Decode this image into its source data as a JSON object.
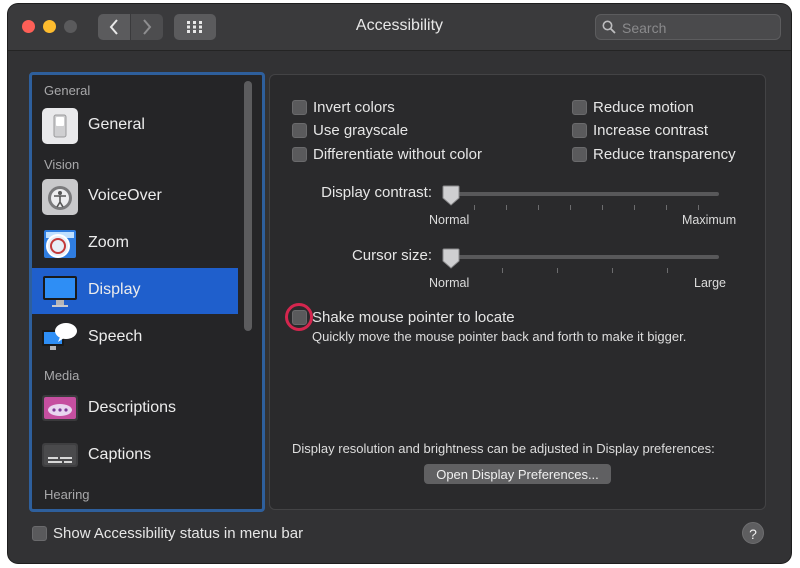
{
  "window": {
    "title": "Accessibility",
    "search_placeholder": "Search"
  },
  "sidebar": {
    "sections": {
      "general": "General",
      "vision": "Vision",
      "media": "Media",
      "hearing": "Hearing"
    },
    "items": [
      {
        "label": "General",
        "icon": "general-switch-icon"
      },
      {
        "label": "VoiceOver",
        "icon": "voiceover-icon"
      },
      {
        "label": "Zoom",
        "icon": "zoom-icon"
      },
      {
        "label": "Display",
        "icon": "display-icon",
        "selected": true
      },
      {
        "label": "Speech",
        "icon": "speech-icon"
      },
      {
        "label": "Descriptions",
        "icon": "descriptions-icon"
      },
      {
        "label": "Captions",
        "icon": "captions-icon"
      }
    ]
  },
  "display": {
    "options_left": [
      {
        "label": "Invert colors",
        "checked": false
      },
      {
        "label": "Use grayscale",
        "checked": false
      },
      {
        "label": "Differentiate without color",
        "checked": false
      }
    ],
    "options_right": [
      {
        "label": "Reduce motion",
        "checked": false
      },
      {
        "label": "Increase contrast",
        "checked": false
      },
      {
        "label": "Reduce transparency",
        "checked": false
      }
    ],
    "contrast_slider": {
      "label": "Display contrast:",
      "min_label": "Normal",
      "max_label": "Maximum",
      "value": 0
    },
    "cursor_slider": {
      "label": "Cursor size:",
      "min_label": "Normal",
      "max_label": "Large",
      "value": 0
    },
    "shake": {
      "label": "Shake mouse pointer to locate",
      "checked": false,
      "description": "Quickly move the mouse pointer back and forth to make it bigger."
    },
    "resolution_note": "Display resolution and brightness can be adjusted in Display preferences:",
    "open_button": "Open Display Preferences..."
  },
  "footer": {
    "status_label": "Show Accessibility status in menu bar",
    "status_checked": false,
    "help": "?"
  },
  "colors": {
    "selection": "#1f5fcc",
    "focus_ring": "#2e5f9c",
    "highlight_ring": "#d4264e"
  }
}
